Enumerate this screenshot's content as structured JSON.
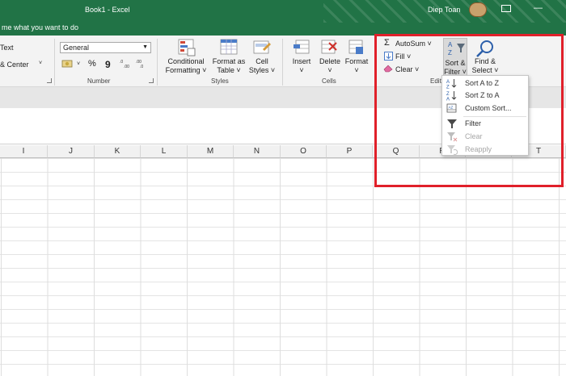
{
  "window": {
    "title": "Book1  -  Excel",
    "user": "Diep Toan",
    "tell_me": "me what you want to do"
  },
  "ribbon": {
    "alignment": {
      "wrap_text": "Text",
      "merge_center": "& Center"
    },
    "number": {
      "format": "General",
      "percent": "%",
      "comma": "9",
      "label": "Number"
    },
    "styles": {
      "conditional": [
        "Conditional",
        "Formatting ˅"
      ],
      "format_table": [
        "Format as",
        "Table ˅"
      ],
      "cell_styles": [
        "Cell",
        "Styles ˅"
      ],
      "label": "Styles"
    },
    "cells": {
      "insert": [
        "Insert",
        "˅"
      ],
      "delete": [
        "Delete",
        "˅"
      ],
      "format": [
        "Format",
        "˅"
      ],
      "label": "Cells"
    },
    "editing": {
      "autosum": "AutoSum ˅",
      "fill": "Fill ˅",
      "clear": "Clear ˅",
      "sort_filter": [
        "Sort &",
        "Filter ˅"
      ],
      "find_select": [
        "Find &",
        "Select ˅"
      ],
      "label": "Editi"
    }
  },
  "menu": {
    "items": [
      {
        "label": "Sort A to Z",
        "icon": "sort-a-z-icon",
        "enabled": true
      },
      {
        "label": "Sort Z to A",
        "icon": "sort-z-a-icon",
        "enabled": true
      },
      {
        "label": "Custom Sort...",
        "icon": "custom-sort-icon",
        "enabled": true
      },
      {
        "label": "Filter",
        "icon": "filter-icon",
        "enabled": true
      },
      {
        "label": "Clear",
        "icon": "clear-filter-icon",
        "enabled": false
      },
      {
        "label": "Reapply",
        "icon": "reapply-icon",
        "enabled": false
      }
    ]
  },
  "columns": [
    "I",
    "J",
    "K",
    "L",
    "M",
    "N",
    "O",
    "P",
    "Q",
    "R",
    "S",
    "T"
  ],
  "colors": {
    "excel_green": "#217346",
    "highlight_red": "#e0202a"
  }
}
